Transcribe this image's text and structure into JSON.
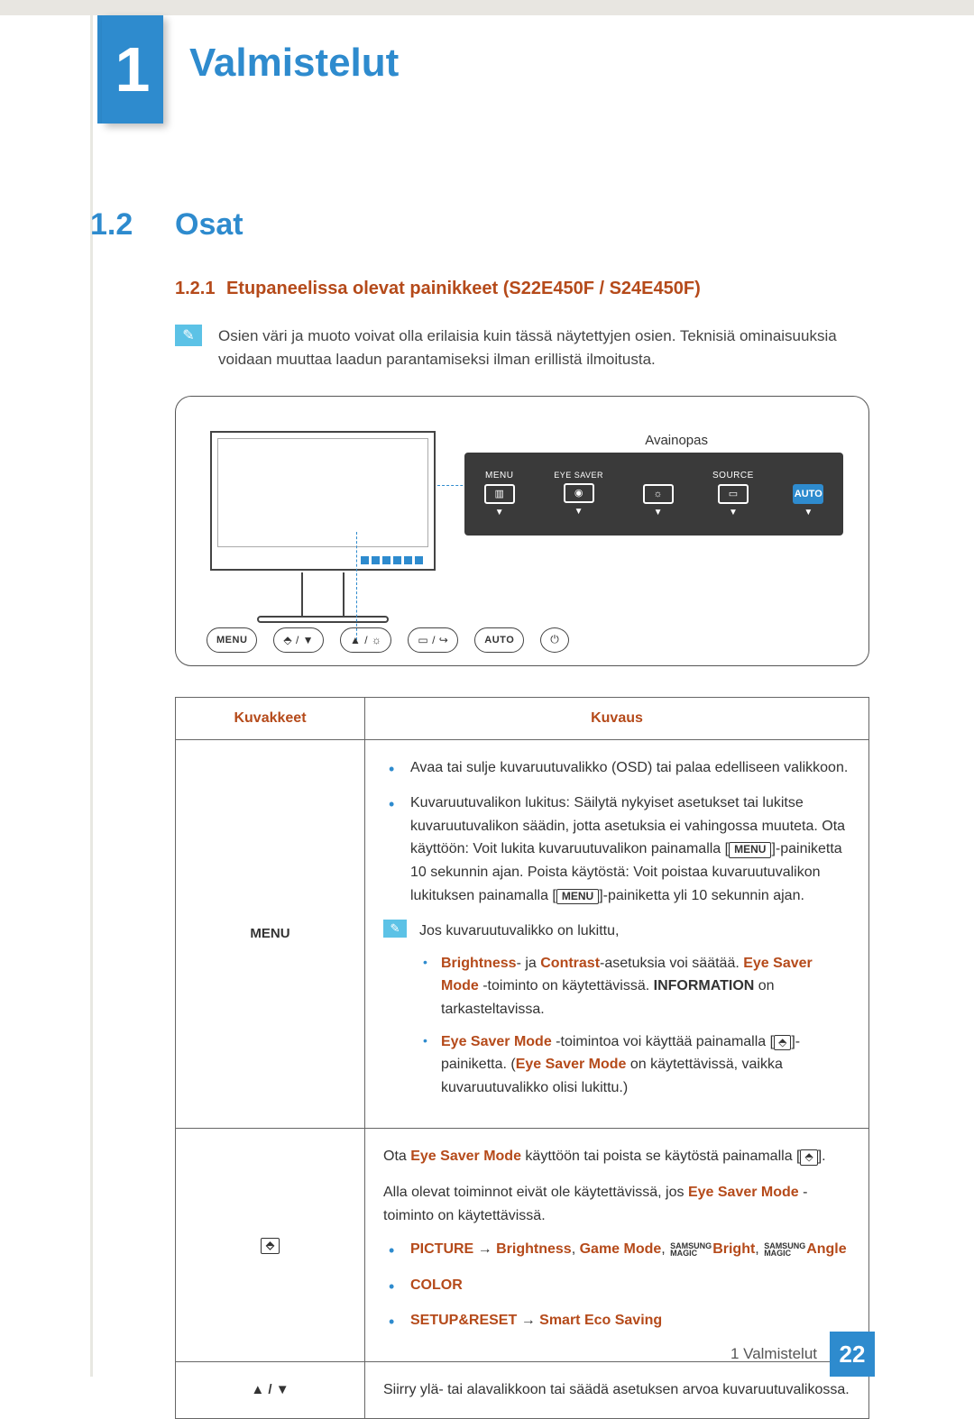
{
  "header": {
    "chapter_number": "1",
    "chapter_title": "Valmistelut"
  },
  "section": {
    "number": "1.2",
    "title": "Osat"
  },
  "subsection": {
    "number": "1.2.1",
    "title": "Etupaneelissa olevat painikkeet (S22E450F / S24E450F)"
  },
  "note": {
    "text": "Osien väri ja muoto voivat olla erilaisia kuin tässä näytettyjen osien. Teknisiä ominaisuuksia voidaan muuttaa laadun parantamiseksi ilman erillistä ilmoitusta."
  },
  "diagram": {
    "key_guide_title": "Avainopas",
    "osd_items": {
      "menu": "MENU",
      "eye_saver": "EYE SAVER",
      "source": "SOURCE",
      "auto": "AUTO"
    },
    "bottom_buttons": {
      "menu": "MENU",
      "eye_nav": "⬘ / ▼",
      "up_sun": "▲ / ☼",
      "src_nav": "▭ / ↪",
      "auto": "AUTO",
      "power": "⏻"
    }
  },
  "table": {
    "headers": {
      "icons": "Kuvakkeet",
      "desc": "Kuvaus"
    },
    "rows": {
      "menu": {
        "icon_label": "MENU",
        "b1": "Avaa tai sulje kuvaruutuvalikko (OSD) tai palaa edelliseen valikkoon.",
        "b2_pre": "Kuvaruutuvalikon lukitus: Säilytä nykyiset asetukset tai lukitse kuvaruutuvalikon säädin, jotta asetuksia ei vahingossa muuteta. Ota käyttöön: Voit lukita kuvaruutuvalikon painamalla [",
        "b2_mid": "]-painiketta 10 sekunnin ajan. Poista käytöstä: Voit poistaa kuvaruutuvalikon lukituksen painamalla [",
        "b2_post": "]-painiketta yli 10 sekunnin ajan.",
        "note_intro": "Jos kuvaruutuvalikko on lukittu,",
        "sb1_a": "Brightness",
        "sb1_b": "- ja ",
        "sb1_c": "Contrast",
        "sb1_d": "-asetuksia voi säätää. ",
        "sb1_e": "Eye Saver Mode",
        "sb1_f": " -toiminto on käytettävissä. ",
        "sb1_g": "INFORMATION",
        "sb1_h": " on tarkasteltavissa.",
        "sb2_a": "Eye Saver Mode",
        "sb2_b": " -toimintoa voi käyttää painamalla [",
        "sb2_c": "]-painiketta. (",
        "sb2_d": "Eye Saver Mode",
        "sb2_e": " on käytettävissä, vaikka kuvaruutuvalikko olisi lukittu.)"
      },
      "eye": {
        "icon_label": "⬘",
        "l1_a": "Ota ",
        "l1_b": "Eye Saver Mode",
        "l1_c": " käyttöön tai poista se käytöstä painamalla [",
        "l1_d": "].",
        "l2_a": "Alla olevat toiminnot eivät ole käytettävissä, jos ",
        "l2_b": "Eye Saver Mode",
        "l2_c": " -toiminto on käytettävissä.",
        "b1_a": "PICTURE",
        "b1_arrow": " → ",
        "b1_b": "Brightness",
        "b1_c": ", ",
        "b1_d": "Game Mode",
        "b1_e": ", ",
        "b1_f": "Bright",
        "b1_g": ", ",
        "b1_h": "Angle",
        "b2": "COLOR",
        "b3_a": "SETUP&RESET",
        "b3_arrow": " → ",
        "b3_b": "Smart Eco Saving"
      },
      "nav": {
        "icon_label": "▲ / ▼",
        "text": "Siirry ylä- tai alavalikkoon tai säädä asetuksen arvoa kuvaruutuvalikossa."
      }
    }
  },
  "magic_label": {
    "top": "SAMSUNG",
    "bottom": "MAGIC"
  },
  "menu_chip": "MENU",
  "eye_chip": "⬘",
  "footer": {
    "chapter_ref": "1 Valmistelut",
    "page": "22"
  }
}
